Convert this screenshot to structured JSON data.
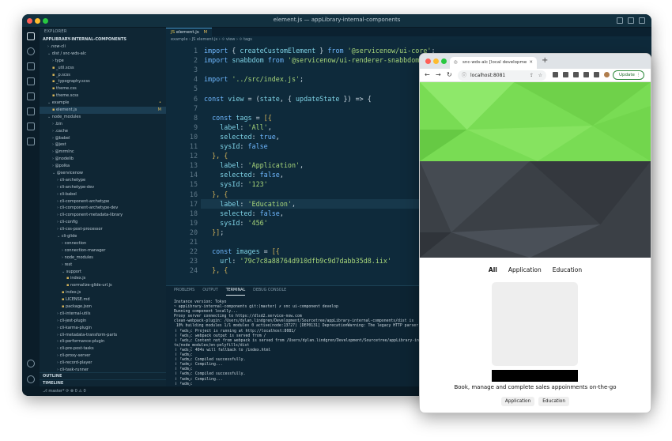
{
  "vscode": {
    "window_title": "element.js — appLibrary-internal-components",
    "colors": {
      "close": "#ff5f57",
      "minimize": "#febc2e",
      "maximize": "#28c840",
      "accent": "#4aa0d8"
    },
    "explorer": {
      "header": "EXPLORER",
      "root": "APPLIBRARY-INTERNAL-COMPONENTS",
      "items": [
        {
          "label": ".now-cli",
          "depth": 1,
          "type": "folder-collapsed"
        },
        {
          "label": "dist / snc-wds-alc",
          "depth": 1,
          "type": "folder-open"
        },
        {
          "label": "type",
          "depth": 2,
          "type": "folder-collapsed"
        },
        {
          "label": "_util.scss",
          "depth": 2,
          "type": "file"
        },
        {
          "label": "_p.scss",
          "depth": 2,
          "type": "file"
        },
        {
          "label": "_typography.scss",
          "depth": 2,
          "type": "file"
        },
        {
          "label": "theme.css",
          "depth": 2,
          "type": "file"
        },
        {
          "label": "theme.scss",
          "depth": 2,
          "type": "file"
        },
        {
          "label": "example",
          "depth": 1,
          "type": "folder-open",
          "badge": "•"
        },
        {
          "label": "element.js",
          "depth": 2,
          "type": "file",
          "badge": "M",
          "selected": true
        },
        {
          "label": "node_modules",
          "depth": 1,
          "type": "folder-open"
        },
        {
          "label": ".bin",
          "depth": 2,
          "type": "folder-collapsed"
        },
        {
          "label": ".cache",
          "depth": 2,
          "type": "folder-collapsed"
        },
        {
          "label": "@babel",
          "depth": 2,
          "type": "folder-collapsed"
        },
        {
          "label": "@jest",
          "depth": 2,
          "type": "folder-collapsed"
        },
        {
          "label": "@mrmlnc",
          "depth": 2,
          "type": "folder-collapsed"
        },
        {
          "label": "@nodelib",
          "depth": 2,
          "type": "folder-collapsed"
        },
        {
          "label": "@polka",
          "depth": 2,
          "type": "folder-collapsed"
        },
        {
          "label": "@servicenow",
          "depth": 2,
          "type": "folder-open"
        },
        {
          "label": "cli-archetype",
          "depth": 3,
          "type": "folder-collapsed"
        },
        {
          "label": "cli-archetype-dev",
          "depth": 3,
          "type": "folder-collapsed"
        },
        {
          "label": "cli-babel",
          "depth": 3,
          "type": "folder-collapsed"
        },
        {
          "label": "cli-component-archetype",
          "depth": 3,
          "type": "folder-collapsed"
        },
        {
          "label": "cli-component-archetype-dev",
          "depth": 3,
          "type": "folder-collapsed"
        },
        {
          "label": "cli-component-metadata-library",
          "depth": 3,
          "type": "folder-collapsed"
        },
        {
          "label": "cli-config",
          "depth": 3,
          "type": "folder-collapsed"
        },
        {
          "label": "cli-css-post-processor",
          "depth": 3,
          "type": "folder-collapsed"
        },
        {
          "label": "cli-glide",
          "depth": 3,
          "type": "folder-open"
        },
        {
          "label": "connection",
          "depth": 4,
          "type": "folder-collapsed"
        },
        {
          "label": "connection-manager",
          "depth": 4,
          "type": "folder-collapsed"
        },
        {
          "label": "node_modules",
          "depth": 4,
          "type": "folder-collapsed"
        },
        {
          "label": "rest",
          "depth": 4,
          "type": "folder-collapsed"
        },
        {
          "label": "support",
          "depth": 4,
          "type": "folder-open"
        },
        {
          "label": "index.js",
          "depth": 5,
          "type": "file"
        },
        {
          "label": "normalize-glide-url.js",
          "depth": 5,
          "type": "file"
        },
        {
          "label": "index.js",
          "depth": 4,
          "type": "file"
        },
        {
          "label": "LICENSE.md",
          "depth": 4,
          "type": "file"
        },
        {
          "label": "package.json",
          "depth": 4,
          "type": "file"
        },
        {
          "label": "cli-internal-utils",
          "depth": 3,
          "type": "folder-collapsed"
        },
        {
          "label": "cli-jest-plugin",
          "depth": 3,
          "type": "folder-collapsed"
        },
        {
          "label": "cli-karma-plugin",
          "depth": 3,
          "type": "folder-collapsed"
        },
        {
          "label": "cli-metadata-transform-parts",
          "depth": 3,
          "type": "folder-collapsed"
        },
        {
          "label": "cli-performance-plugin",
          "depth": 3,
          "type": "folder-collapsed"
        },
        {
          "label": "cli-pre-post-tasks",
          "depth": 3,
          "type": "folder-collapsed"
        },
        {
          "label": "cli-proxy-server",
          "depth": 3,
          "type": "folder-collapsed"
        },
        {
          "label": "cli-record-player",
          "depth": 3,
          "type": "folder-collapsed"
        },
        {
          "label": "cli-task-runner",
          "depth": 3,
          "type": "folder-collapsed"
        }
      ],
      "outline": "OUTLINE",
      "timeline": "TIMELINE"
    },
    "tab": {
      "label": "element.js",
      "modified": "M"
    },
    "breadcrumb": "example › JS element.js › ⟐ view › ⟐ tags",
    "code_lines": [
      {
        "n": "1",
        "html": "<span class='k'>import</span> { <span class='v'>createCustomElement</span> } <span class='k'>from</span> <span class='s'>'@servicenow/ui-core'</span>;"
      },
      {
        "n": "2",
        "html": "<span class='k'>import</span> <span class='v'>snabbdom</span> <span class='k'>from</span> <span class='s'>'@servicenow/ui-renderer-snabbdom'</span>;"
      },
      {
        "n": "3",
        "html": ""
      },
      {
        "n": "4",
        "html": "<span class='k'>import</span> <span class='s'>'../src/index.js'</span>;"
      },
      {
        "n": "5",
        "html": ""
      },
      {
        "n": "6",
        "html": "<span class='k'>const</span> <span class='v'>view</span> = (<span class='v'>state</span>, { <span class='v'>updateState</span> }) => {"
      },
      {
        "n": "7",
        "html": ""
      },
      {
        "n": "8",
        "html": "  <span class='k'>const</span> <span class='v'>tags</span> = <span class='p'>[{</span>"
      },
      {
        "n": "9",
        "html": "    <span class='v'>label</span>: <span class='s'>'All'</span>,"
      },
      {
        "n": "10",
        "html": "    <span class='v'>selected</span>: <span class='k'>true</span>,"
      },
      {
        "n": "11",
        "html": "    <span class='v'>sysId</span>: <span class='k'>false</span>"
      },
      {
        "n": "12",
        "html": "  <span class='p'>}, {</span>"
      },
      {
        "n": "13",
        "html": "    <span class='v'>label</span>: <span class='s'>'Application'</span>,"
      },
      {
        "n": "14",
        "html": "    <span class='v'>selected</span>: <span class='k'>false</span>,"
      },
      {
        "n": "15",
        "html": "    <span class='v'>sysId</span>: <span class='s'>'123'</span>"
      },
      {
        "n": "16",
        "html": "  <span class='p'>}, {</span>"
      },
      {
        "n": "17",
        "html": "    <span class='v'>label</span>: <span class='s'>'Education'</span>,"
      },
      {
        "n": "18",
        "html": "    <span class='v'>selected</span>: <span class='k'>false</span>,"
      },
      {
        "n": "19",
        "html": "    <span class='v'>sysId</span>: <span class='s'>'456'</span>"
      },
      {
        "n": "20",
        "html": "  <span class='p'>}]</span>;"
      },
      {
        "n": "21",
        "html": ""
      },
      {
        "n": "22",
        "html": "  <span class='k'>const</span> <span class='v'>images</span> = <span class='p'>[{</span>"
      },
      {
        "n": "23",
        "html": "    <span class='v'>url</span>: <span class='s'>'79c7c8a88764d910dfb9c9d7dabb35d8.iix'</span>"
      },
      {
        "n": "24",
        "html": "  <span class='p'>}, {</span>"
      }
    ],
    "panel_tabs": [
      "PROBLEMS",
      "OUTPUT",
      "TERMINAL",
      "DEBUG CONSOLE"
    ],
    "active_panel": "TERMINAL",
    "terminal": "Instance version: Tokyo\n~ appLibrary-internal-components git:(master) ✗ snc ui-component develop\nRunning component locally...\nProxy server connecting to https://dlsd2.service-now.com\nclean-webpack-plugin: /Users/dylan.lindgren/Development/Sourcetree/appLibrary-internal-components/dist is\n 10% building modules 1/1 modules 0 active(node:13727) [DEP0131] DeprecationWarning: The legacy HTTP parser\nｉ ｢wds｣: Project is running at http://localhost:8081/\nｉ ｢wds｣: webpack output is served from /\nｉ ｢wds｣: Content not from webpack is served from /Users/dylan.lindgren/Development/Sourcetree/appLibrary-in\nts/node_modules/en-polyfills/dist\nｉ ｢wds｣: 404s will fallback to /index.html\nｉ ｢wdm｣:\nｉ ｢wdm｣: Compiled successfully.\nｉ ｢wdm｣: Compiling...\nｉ ｢wdm｣:\nｉ ｢wdm｣: Compiled successfully.\nｉ ｢wdm｣: Compiling...\nｉ ｢wdm｣:\nｉ ｢wdm｣: Compiled successfully.\nclear\n▯",
    "status": "⎇ master*   ⟳   ⊗ 0 ⚠ 0"
  },
  "browser": {
    "tab_title": "snc-wds-alc [local developme",
    "url": "localhost:8081",
    "update_label": "Update",
    "tags": [
      {
        "label": "All",
        "selected": true
      },
      {
        "label": "Application",
        "selected": false
      },
      {
        "label": "Education",
        "selected": false
      }
    ],
    "tagline": "Book, manage and complete sales appoinments on-the-go",
    "pill_tags": [
      "Application",
      "Education"
    ],
    "colors": {
      "hero_top": "#7fe05a",
      "hero_bottom": "#3a3f45"
    }
  }
}
